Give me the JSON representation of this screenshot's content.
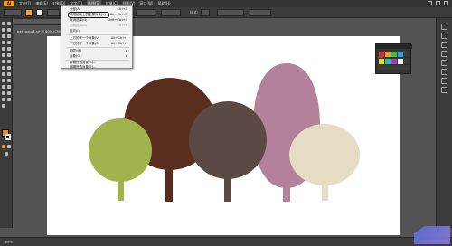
{
  "app": {
    "logo": "Ai",
    "menu": [
      "文件(F)",
      "编辑(E)",
      "对象(O)",
      "文字(T)",
      "选择(S)",
      "效果(C)",
      "视图(V)",
      "窗口(W)",
      "帮助(H)"
    ]
  },
  "controlbar": {
    "style_label": "样式:"
  },
  "document": {
    "tab_title": "ba4ogocu3.ai* @ 60% (CMYK/预览)",
    "zoom": "66%"
  },
  "dropdown": {
    "items": [
      {
        "label": "全部(A)",
        "shortcut": "Ctrl+A",
        "disabled": false
      },
      {
        "label": "现用画板上的全部对象(L)",
        "shortcut": "Alt+Ctrl+A",
        "disabled": false,
        "highlighted": true
      },
      {
        "label": "取消选择(D)",
        "shortcut": "Shift+Ctrl+A",
        "disabled": false
      },
      {
        "label": "重新选择(R)",
        "shortcut": "Ctrl+6",
        "disabled": true
      },
      {
        "label": "反向(I)",
        "shortcut": "",
        "disabled": false
      },
      {
        "label": "上方的下一个对象(V)",
        "shortcut": "Alt+Ctrl+]",
        "disabled": false
      },
      {
        "label": "下方的下一个对象(B)",
        "shortcut": "Alt+Ctrl+[",
        "disabled": false
      },
      {
        "label": "相同(M)",
        "shortcut": "▸",
        "disabled": false
      },
      {
        "label": "对象(O)",
        "shortcut": "▸",
        "disabled": false
      },
      {
        "label": "存储所选对象(S)...",
        "shortcut": "",
        "disabled": false
      },
      {
        "label": "编辑所选对象(E)...",
        "shortcut": "",
        "disabled": false
      }
    ]
  },
  "panel": {
    "tab_label": "色板"
  },
  "colors": {
    "green_tree": "#a0b34c",
    "brown_tree": "#5a2e1e",
    "gray_tree": "#5b4a43",
    "pink_tree": "#b3819a",
    "cream_tree": "#e5dcc4",
    "fill_swatch": "#f08a20"
  },
  "icons": [
    "selection-icon",
    "direct-selection-icon",
    "magic-wand-icon",
    "lasso-icon",
    "pen-icon",
    "type-icon",
    "line-icon",
    "rectangle-icon",
    "paintbrush-icon",
    "pencil-icon",
    "eraser-icon",
    "rotate-icon",
    "scale-icon",
    "width-icon",
    "free-transform-icon",
    "shape-builder-icon",
    "perspective-icon",
    "mesh-icon",
    "gradient-icon",
    "eyedropper-icon",
    "blend-icon",
    "symbol-sprayer-icon",
    "graph-icon",
    "artboard-icon",
    "slice-icon",
    "hand-icon",
    "zoom-icon"
  ]
}
